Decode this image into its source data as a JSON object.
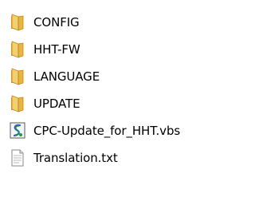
{
  "files": [
    {
      "name": "CONFIG",
      "icon": "folder-icon"
    },
    {
      "name": "HHT-FW",
      "icon": "folder-icon"
    },
    {
      "name": "LANGUAGE",
      "icon": "folder-icon"
    },
    {
      "name": "UPDATE",
      "icon": "folder-icon"
    },
    {
      "name": "CPC-Update_for_HHT.vbs",
      "icon": "vbs-script-icon"
    },
    {
      "name": "Translation.txt",
      "icon": "text-file-icon"
    }
  ],
  "colors": {
    "folder_light": "#f6db8a",
    "folder_dark": "#d9a22e",
    "folder_shadow": "#b98118",
    "script_green": "#2a9a2a",
    "script_blue": "#2f5fc4",
    "text_page": "#ffffff",
    "text_border": "#8a8a8a"
  }
}
